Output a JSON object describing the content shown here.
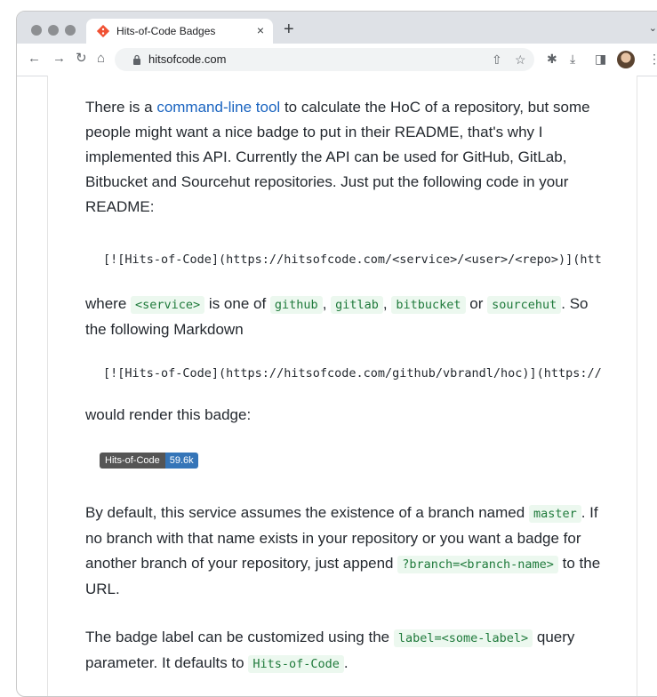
{
  "browser": {
    "tab_title": "Hits-of-Code Badges",
    "tab_close": "×",
    "new_tab": "+",
    "tab_dropdown": "⌄",
    "nav_back": "←",
    "nav_forward": "→",
    "nav_reload": "↻",
    "nav_home": "⌂",
    "url": "hitsofcode.com",
    "share_icon": "⇧",
    "bookmark_icon": "☆",
    "extensions_icon": "✱",
    "download_icon": "⤓",
    "sidepanel_icon": "◨",
    "menu_icon": "⋮"
  },
  "content": {
    "p1_pre": "There is a ",
    "p1_link": "command-line tool",
    "p1_post": " to calculate the HoC of a repository, but some people might want a nice badge to put in their README, that's why I implemented this API. Currently the API can be used for GitHub, GitLab, Bitbucket and Sourcehut repositories. Just put the following code in your README:",
    "code1": "[![Hits-of-Code](https://hitsofcode.com/<service>/<user>/<repo>)](htt",
    "p2_where": "where ",
    "p2_service": "<service>",
    "p2_isone": " is one of ",
    "p2_github": "github",
    "p2_comma1": ", ",
    "p2_gitlab": "gitlab",
    "p2_comma2": ", ",
    "p2_bitbucket": "bitbucket",
    "p2_or": " or ",
    "p2_sourcehut": "sourcehut",
    "p2_post": ". So the following Markdown",
    "code2": "[![Hits-of-Code](https://hitsofcode.com/github/vbrandl/hoc)](https://",
    "p3": "would render this badge:",
    "badge_label": "Hits-of-Code",
    "badge_value": "59.6k",
    "p4_pre": "By default, this service assumes the existence of a branch named ",
    "p4_master": "master",
    "p4_mid": ". If no branch with that name exists in your repository or you want a badge for another branch of your repository, just append ",
    "p4_branch": "?branch=<branch-name>",
    "p4_post": " to the URL.",
    "p5_pre": "The badge label can be customized using the ",
    "p5_label": "label=<some-label>",
    "p5_mid": " query parameter. It defaults to ",
    "p5_default": "Hits-of-Code",
    "p5_post": "."
  }
}
